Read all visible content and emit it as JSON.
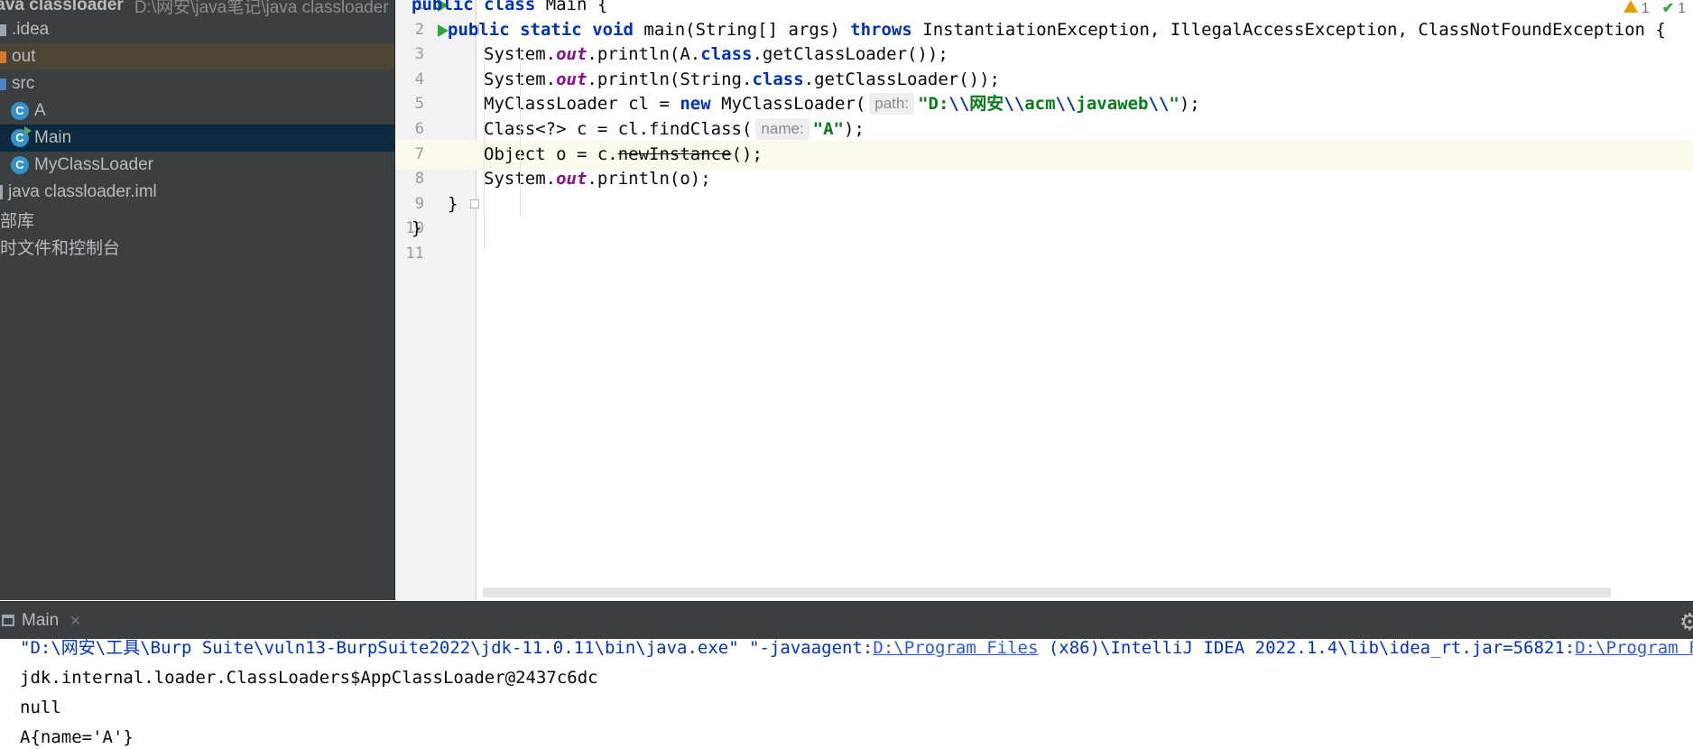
{
  "project_tree": {
    "root_label": "java classloader",
    "root_path": "D:\\网安\\java笔记\\java classloader",
    "items": [
      {
        "label": ".idea",
        "kind": "folder",
        "color": "#9aa7b0"
      },
      {
        "label": "out",
        "kind": "folder",
        "color": "#d37b2a"
      },
      {
        "label": "src",
        "kind": "folder",
        "color": "#4a86c7"
      },
      {
        "label": "A",
        "kind": "class"
      },
      {
        "label": "Main",
        "kind": "class-main"
      },
      {
        "label": "MyClassLoader",
        "kind": "class"
      },
      {
        "label": "java classloader.iml",
        "kind": "file"
      },
      {
        "label": "部库",
        "kind": "lib"
      },
      {
        "label": "时文件和控制台",
        "kind": "scratch"
      }
    ]
  },
  "editor": {
    "warning_count": "1",
    "ok_count": "1",
    "lines": [
      {
        "num": "1",
        "segments": [
          [
            "kw",
            "public"
          ],
          [
            "p",
            " "
          ],
          [
            "kw",
            "class"
          ],
          [
            "p",
            " Main {"
          ]
        ]
      },
      {
        "num": "2",
        "segments": [
          [
            "kw",
            "public"
          ],
          [
            "p",
            " "
          ],
          [
            "kw",
            "static"
          ],
          [
            "p",
            " "
          ],
          [
            "kw",
            "void"
          ],
          [
            "p",
            " main(String[] args) "
          ],
          [
            "kw",
            "throws"
          ],
          [
            "p",
            " InstantiationException, IllegalAccessException, ClassNotFoundException {"
          ]
        ]
      },
      {
        "num": "3",
        "segments": [
          [
            "p",
            "System."
          ],
          [
            "fld",
            "out"
          ],
          [
            "p",
            ".println(A."
          ],
          [
            "kw",
            "class"
          ],
          [
            "p",
            ".getClassLoader());"
          ]
        ]
      },
      {
        "num": "4",
        "segments": [
          [
            "p",
            "System."
          ],
          [
            "fld",
            "out"
          ],
          [
            "p",
            ".println(String."
          ],
          [
            "kw",
            "class"
          ],
          [
            "p",
            ".getClassLoader());"
          ]
        ]
      },
      {
        "num": "5",
        "segments": [
          [
            "p",
            "MyClassLoader cl = "
          ],
          [
            "kw",
            "new"
          ],
          [
            "p",
            " MyClassLoader("
          ],
          [
            "hint",
            "path:"
          ],
          [
            "str",
            "\"D:"
          ],
          [
            "esc",
            "\\\\"
          ],
          [
            "str",
            "网安"
          ],
          [
            "esc",
            "\\\\"
          ],
          [
            "str",
            "acm"
          ],
          [
            "esc",
            "\\\\"
          ],
          [
            "str",
            "javaweb"
          ],
          [
            "esc",
            "\\\\"
          ],
          [
            "str",
            "\""
          ],
          [
            "p",
            ");"
          ]
        ]
      },
      {
        "num": "6",
        "segments": [
          [
            "p",
            "Class<?> c = cl.findClass("
          ],
          [
            "hint",
            "name:"
          ],
          [
            "str",
            "\"A\""
          ],
          [
            "p",
            ");"
          ]
        ]
      },
      {
        "num": "7",
        "segments": [
          [
            "p",
            "Object o = c."
          ],
          [
            "strike",
            "newInstance"
          ],
          [
            "p",
            "();"
          ]
        ]
      },
      {
        "num": "8",
        "segments": [
          [
            "p",
            "System."
          ],
          [
            "fld",
            "out"
          ],
          [
            "p",
            ".println(o);"
          ]
        ]
      },
      {
        "num": "9",
        "segments": [
          [
            "p",
            "}"
          ]
        ]
      },
      {
        "num": "10",
        "segments": [
          [
            "p",
            "}"
          ]
        ]
      },
      {
        "num": "11",
        "segments": []
      }
    ]
  },
  "run_panel": {
    "tab_label": "Main",
    "output": [
      {
        "parts": [
          [
            "t",
            "\"D:\\网安\\工具\\Burp Suite\\vuln13-BurpSuite2022\\jdk-11.0.11\\bin\\java.exe\" \"-javaagent:"
          ],
          [
            "link",
            "D:\\Program Files"
          ],
          [
            "t",
            " (x86)\\IntelliJ IDEA 2022.1.4\\lib\\idea_rt.jar=56821:"
          ],
          [
            "link",
            "D:\\Program Files"
          ]
        ]
      },
      {
        "parts": [
          [
            "t",
            "jdk.internal.loader.ClassLoaders$AppClassLoader@2437c6dc"
          ]
        ]
      },
      {
        "parts": [
          [
            "t",
            "null"
          ]
        ]
      },
      {
        "parts": [
          [
            "t",
            "A{name='A'}"
          ]
        ]
      }
    ]
  }
}
